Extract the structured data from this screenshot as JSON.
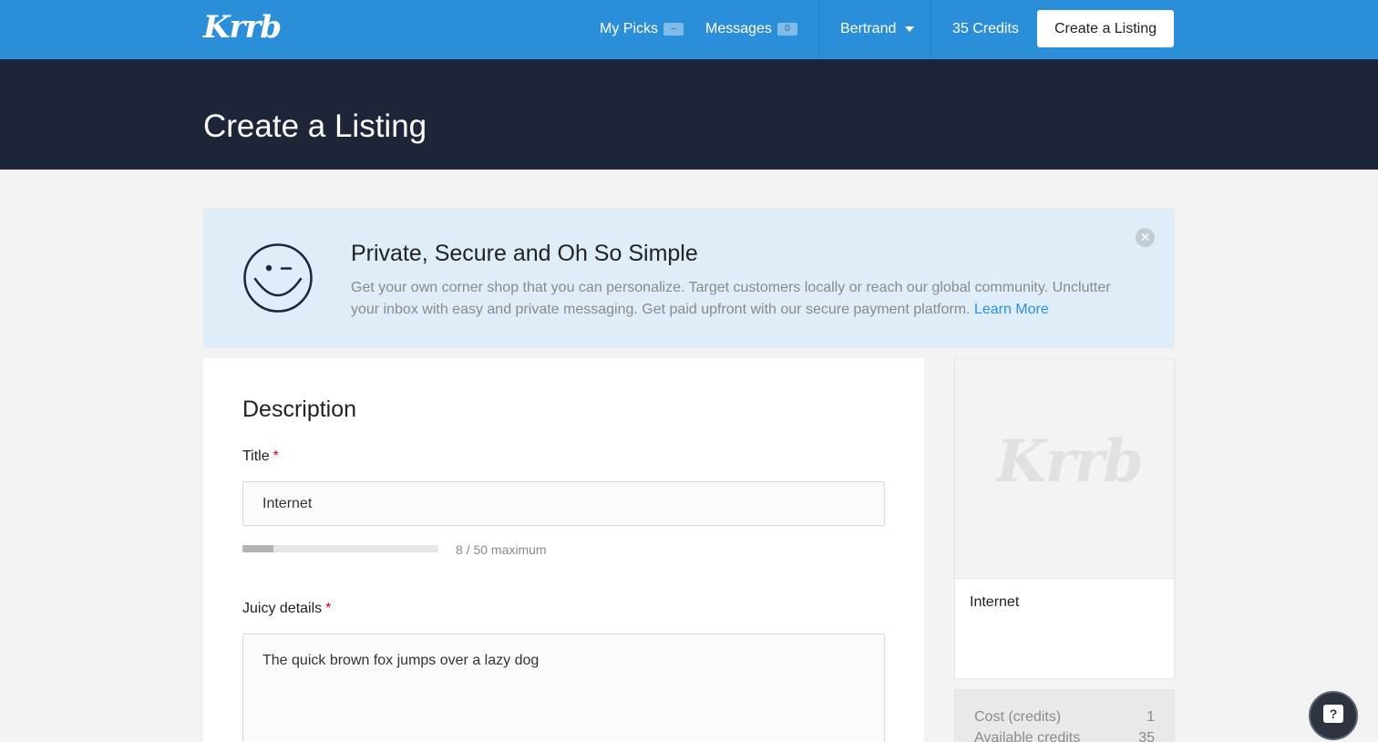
{
  "header": {
    "logo": "Krrb",
    "my_picks_label": "My Picks",
    "my_picks_badge": "–",
    "messages_label": "Messages",
    "messages_badge": "0",
    "user_name": "Bertrand",
    "credits_label": "35 Credits",
    "create_button": "Create a Listing",
    "brand_color": "#2a8fd8"
  },
  "hero": {
    "title": "Create a Listing"
  },
  "banner": {
    "icon": "wink-smiley-icon",
    "title": "Private, Secure and Oh So Simple",
    "text": "Get your own corner shop that you can personalize. Target customers locally or reach our global community. Unclutter your inbox with easy and private messaging. Get paid upfront with our secure payment platform.",
    "link": "Learn More",
    "close_icon": "close-icon"
  },
  "form": {
    "section_title": "Description",
    "title_label": "Title",
    "title_value": "Internet",
    "title_progress_fraction": 0.16,
    "title_counter": "8 / 50 maximum",
    "details_label": "Juicy details",
    "details_value": "The quick brown fox jumps over a lazy dog",
    "required_marker": "*"
  },
  "preview": {
    "logo": "Krrb",
    "title": "Internet"
  },
  "cost": {
    "rows": [
      {
        "label": "Cost (credits)",
        "value": "1"
      },
      {
        "label": "Available credits",
        "value": "35"
      }
    ]
  },
  "help": {
    "icon": "help-icon",
    "glyph": "?"
  }
}
